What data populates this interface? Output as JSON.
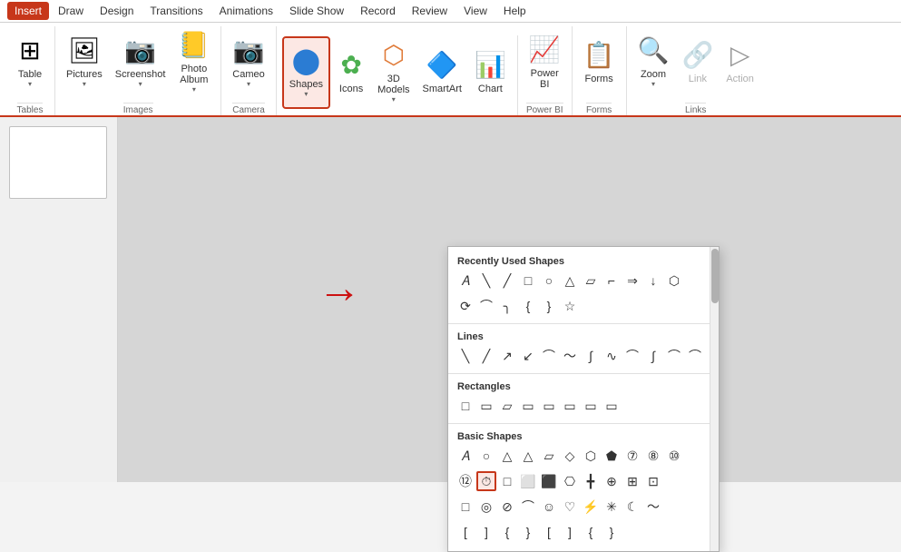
{
  "menubar": {
    "items": [
      "Insert",
      "Draw",
      "Design",
      "Transitions",
      "Animations",
      "Slide Show",
      "Record",
      "Review",
      "View",
      "Help"
    ]
  },
  "ribbon": {
    "groups": [
      {
        "id": "tables",
        "label": "Tables",
        "buttons": [
          {
            "id": "table",
            "label": "Table",
            "icon": "⊞"
          }
        ]
      },
      {
        "id": "images",
        "label": "Images",
        "buttons": [
          {
            "id": "pictures",
            "label": "Pictures",
            "icon": "🖼"
          },
          {
            "id": "screenshot",
            "label": "Screenshot",
            "icon": "📷"
          },
          {
            "id": "photo-album",
            "label": "Photo\nAlbum",
            "icon": "📒"
          }
        ]
      },
      {
        "id": "camera",
        "label": "Camera",
        "buttons": [
          {
            "id": "cameo",
            "label": "Cameo",
            "icon": "🎥"
          }
        ]
      },
      {
        "id": "illustrations",
        "label": "",
        "buttons": [
          {
            "id": "shapes",
            "label": "Shapes",
            "icon": "⬤",
            "active": true
          },
          {
            "id": "icons",
            "label": "Icons",
            "icon": "✿"
          },
          {
            "id": "3d-models",
            "label": "3D\nModels",
            "icon": "🧊"
          },
          {
            "id": "smartart",
            "label": "SmartArt",
            "icon": "🔷"
          },
          {
            "id": "chart",
            "label": "Chart",
            "icon": "📊"
          }
        ]
      },
      {
        "id": "powerbi",
        "label": "Power BI",
        "buttons": [
          {
            "id": "powerbi",
            "label": "Power\nBI",
            "icon": "📈"
          }
        ]
      },
      {
        "id": "forms",
        "label": "Forms",
        "buttons": [
          {
            "id": "forms",
            "label": "Forms",
            "icon": "📋"
          }
        ]
      },
      {
        "id": "links",
        "label": "Links",
        "buttons": [
          {
            "id": "zoom",
            "label": "Zoom",
            "icon": "🔍"
          },
          {
            "id": "link",
            "label": "Link",
            "icon": "🔗",
            "disabled": true
          },
          {
            "id": "action",
            "label": "Action",
            "icon": "▶",
            "disabled": true
          }
        ]
      }
    ]
  },
  "shapes_panel": {
    "sections": [
      {
        "id": "recently-used",
        "title": "Recently Used Shapes",
        "rows": [
          [
            "A",
            "╲",
            "╱",
            "□",
            "○",
            "△",
            "⟨",
            "⟩",
            "⇒",
            "↓",
            "⬡"
          ],
          [
            "⟳",
            "⌒",
            "╮",
            "{ ",
            "}",
            "☆"
          ]
        ]
      },
      {
        "id": "lines",
        "title": "Lines",
        "rows": [
          [
            "╲",
            "╱",
            "↗",
            "↙",
            "〜",
            "〜",
            "∫",
            "∿",
            "⌒",
            "∫",
            "⌒",
            "⌒"
          ]
        ]
      },
      {
        "id": "rectangles",
        "title": "Rectangles",
        "rows": [
          [
            "□",
            "▭",
            "▱",
            "▭",
            "▭",
            "▭",
            "▭",
            "▭"
          ]
        ]
      },
      {
        "id": "basic-shapes",
        "title": "Basic Shapes",
        "rows": [
          [
            "A",
            "○",
            "△",
            "△",
            "▱",
            "◇",
            "⬡",
            "⬟",
            "⑦",
            "⑧",
            "⑩"
          ],
          [
            "⑫",
            "⏱",
            "□",
            "⬜",
            "⬛",
            "⎔",
            "╋",
            "⊕",
            "⊞",
            "⊡"
          ],
          [
            "□",
            "◎",
            "⊘",
            "⌒",
            "☺",
            "♡",
            "⚡",
            "✳",
            "☾",
            "〜"
          ],
          [
            "[",
            "]",
            "{",
            "}",
            "[",
            "]",
            "{",
            "}"
          ]
        ]
      }
    ],
    "highlighted_shape": "⏱"
  },
  "arrow": {
    "symbol": "→",
    "color": "#cc1111"
  }
}
